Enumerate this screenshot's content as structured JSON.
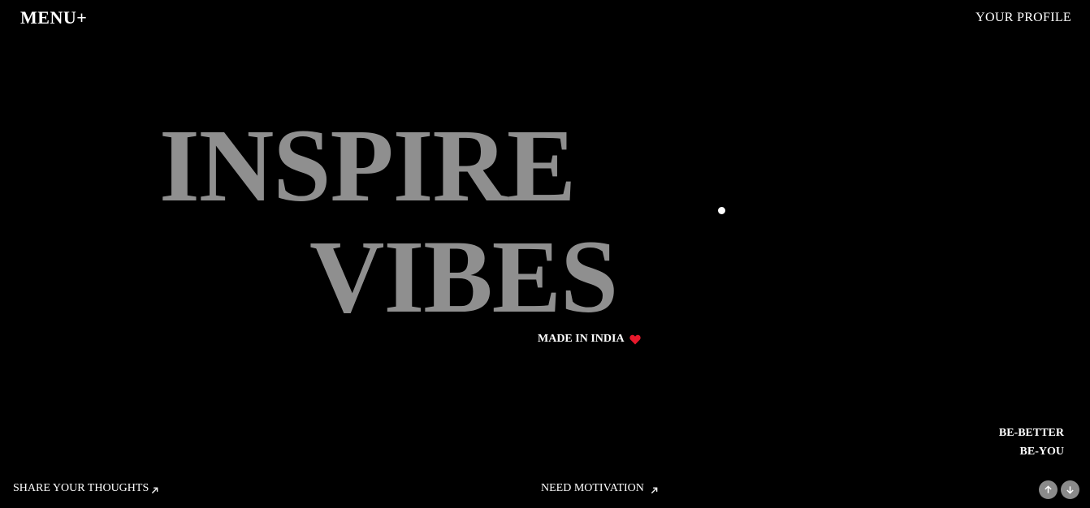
{
  "header": {
    "menu_label": "MENU+",
    "profile_label": "YOUR PROFILE"
  },
  "hero": {
    "line1": "INSPIRE",
    "line2": "VIBES",
    "made_in": "MADE IN INDIA",
    "heart_color": "#e8192c",
    "title_color": "#8f8f8f"
  },
  "tagline": {
    "line1": "BE-BETTER",
    "line2": "BE-YOU"
  },
  "footer": {
    "share_label": "SHARE YOUR THOUGHTS",
    "motivation_label": "NEED MOTIVATION",
    "link_icon": "arrow-up-right-icon",
    "scroll_up_icon": "arrow-up-icon",
    "scroll_down_icon": "arrow-down-icon"
  }
}
